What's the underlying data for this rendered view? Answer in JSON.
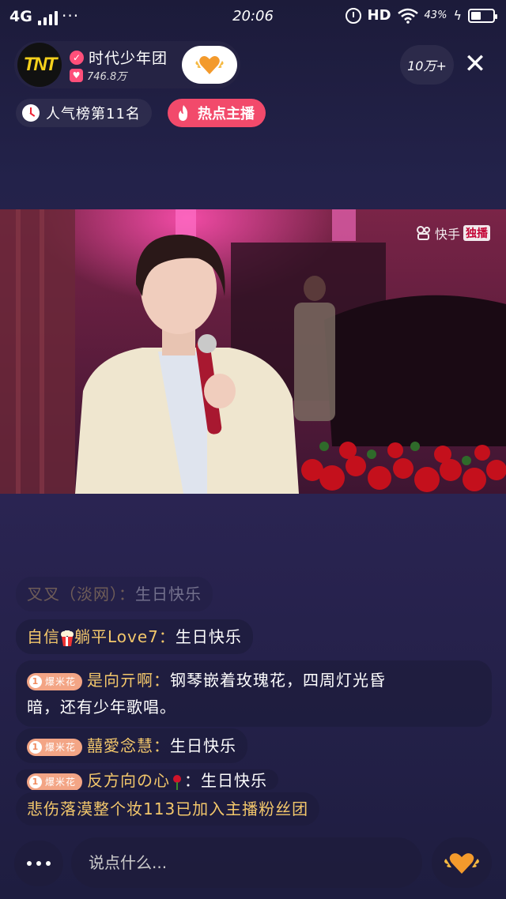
{
  "status_bar": {
    "network": "4G",
    "time": "20:06",
    "hd": "HD",
    "battery": "43%"
  },
  "header": {
    "anchor_name": "时代少年团",
    "likes": "746.8万",
    "avatar_logo": "TNT",
    "viewers": "10万+"
  },
  "tags": {
    "rank": "人气榜第11名",
    "hot": "热点主播"
  },
  "video": {
    "watermark_brand": "快手",
    "watermark_tag": "独播"
  },
  "chat": {
    "messages": [
      {
        "user": "叉叉（淡网）：",
        "text": "生日快乐"
      },
      {
        "user_a": "自信",
        "user_b": "躺平Love7：",
        "text": "生日快乐"
      },
      {
        "badge_level": "1",
        "badge": "爆米花",
        "user": "是向亓啊：",
        "text": "钢琴嵌着玫瑰花，四周灯光昏",
        "text2": "暗，还有少年歌唱。"
      },
      {
        "badge_level": "1",
        "badge": "爆米花",
        "user": "囍愛念慧：",
        "text": "生日快乐"
      },
      {
        "badge_level": "1",
        "badge": "爆米花",
        "user": "反方向の心",
        "text": "：生日快乐"
      }
    ],
    "join_notice": "悲伤落漠整个妆113已加入主播粉丝团"
  },
  "bottom": {
    "input_placeholder": "说点什么..."
  },
  "colors": {
    "accent_pink": "#f24a6b",
    "username_gold": "#f3c76b",
    "badge_orange": "#f3a585"
  }
}
